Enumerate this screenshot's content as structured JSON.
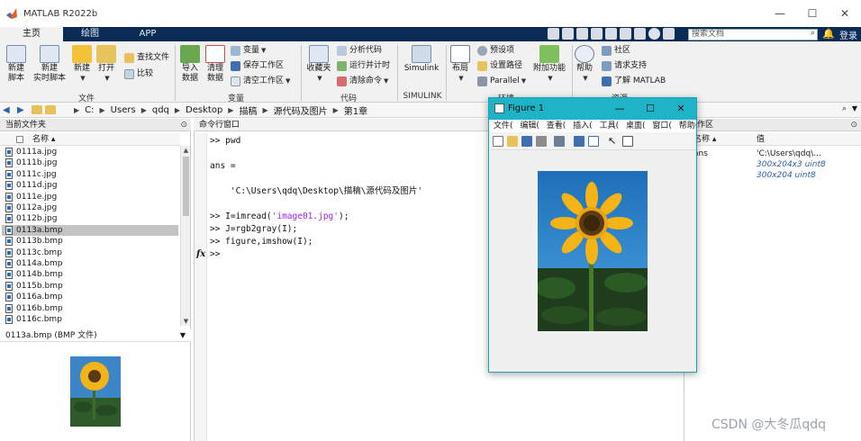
{
  "window": {
    "title": "MATLAB R2022b",
    "controls": [
      "—",
      "☐",
      "✕"
    ]
  },
  "tabs": [
    {
      "label": "主页",
      "active": true
    },
    {
      "label": "绘图",
      "active": false
    },
    {
      "label": "APP",
      "active": false
    }
  ],
  "search": {
    "placeholder": "搜索文档"
  },
  "account": {
    "login": "登录"
  },
  "ribbon": {
    "file": {
      "new_script": [
        "新建",
        "脚本"
      ],
      "new_live": [
        "新建",
        "实时脚本"
      ],
      "new": "新建",
      "open": "打开",
      "find_files": "查找文件",
      "compare": "比较",
      "group": "文件"
    },
    "variable": {
      "import": [
        "导入",
        "数据"
      ],
      "clean": [
        "清理",
        "数据"
      ],
      "variable": "变量",
      "save_ws": "保存工作区",
      "clear_ws": "清空工作区",
      "group": "变量"
    },
    "code": {
      "favorites": "收藏夹",
      "analyze": "分析代码",
      "run_time": "运行并计时",
      "clear_cmd": "清除命令",
      "group": "代码"
    },
    "simulink": {
      "label": "Simulink",
      "group": "SIMULINK"
    },
    "environment": {
      "layout": "布局",
      "prefs": "预设项",
      "set_path": "设置路径",
      "parallel": "Parallel",
      "addons": [
        "附加功能"
      ],
      "group": "环境"
    },
    "resources": {
      "help": "帮助",
      "community": "社区",
      "support": "请求支持",
      "learn": "了解 MATLAB",
      "group": "资源"
    }
  },
  "address": {
    "crumbs": [
      "C:",
      "Users",
      "qdq",
      "Desktop",
      "描稿",
      "源代码及图片",
      "第1章"
    ]
  },
  "file_browser": {
    "title": "当前文件夹",
    "col_name": "名称 ▴",
    "files": [
      "0111a.jpg",
      "0111b.jpg",
      "0111c.jpg",
      "0111d.jpg",
      "0111e.jpg",
      "0112a.jpg",
      "0112b.jpg",
      "0113a.bmp",
      "0113b.bmp",
      "0113c.bmp",
      "0114a.bmp",
      "0114b.bmp",
      "0115b.bmp",
      "0116a.bmp",
      "0116b.bmp",
      "0116c.bmp"
    ],
    "selected": "0113a.bmp",
    "detail_title": "0113a.bmp  (BMP 文件)"
  },
  "command_window": {
    "title": "命令行窗口",
    "lines": [
      {
        "parts": [
          ">> pwd"
        ]
      },
      {
        "parts": [
          ""
        ]
      },
      {
        "parts": [
          "ans ="
        ]
      },
      {
        "parts": [
          ""
        ]
      },
      {
        "parts": [
          "    'C:\\Users\\qdq\\Desktop\\描稿\\源代码及图片'"
        ]
      },
      {
        "parts": [
          ""
        ]
      },
      {
        "pre": ">> I=imread(",
        "str": "'image01.jpg'",
        "post": ");"
      },
      {
        "parts": [
          ">> J=rgb2gray(I);"
        ]
      },
      {
        "parts": [
          ">> figure,imshow(I);"
        ]
      },
      {
        "parts": [
          ">>"
        ]
      }
    ],
    "fx": "fx"
  },
  "workspace": {
    "title": "工作区",
    "col_name": "名称 ▴",
    "col_value": "值",
    "rows": [
      {
        "name": "ans",
        "value": "'C:\\Users\\qdq\\...",
        "italic": false
      },
      {
        "name": "I",
        "value": "300x204x3 uint8",
        "italic": true
      },
      {
        "name": "J",
        "value": "300x204 uint8",
        "italic": true
      }
    ]
  },
  "figure": {
    "title": "Figure 1",
    "menu": [
      "文件(",
      "编辑(",
      "查看(",
      "插入(",
      "工具(",
      "桌面(",
      "窗口(",
      "帮助("
    ],
    "menu_more": "»"
  },
  "watermark": "CSDN @大冬瓜qdq",
  "colors": {
    "tabstrip": "#0a2b55",
    "figure_title": "#1eb3c6",
    "selected_row": "#c3c3c3",
    "string_purple": "#a020f0",
    "ws_blue": "#2b5fa8"
  }
}
